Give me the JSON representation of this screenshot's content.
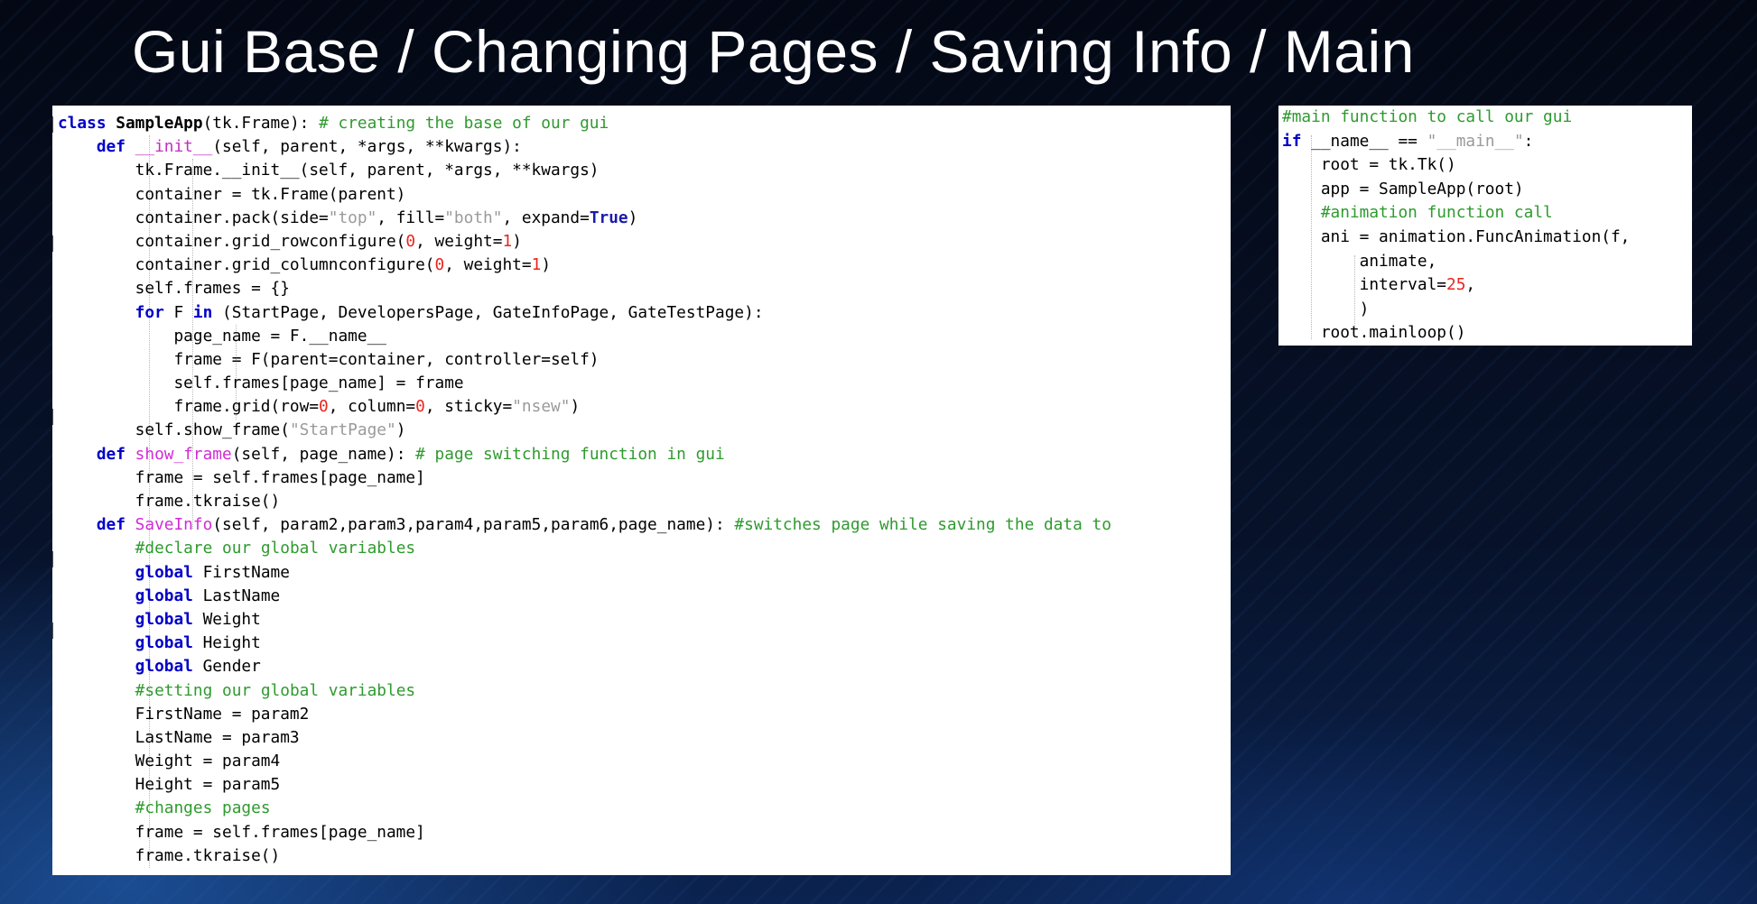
{
  "slide": {
    "title": "Gui Base / Changing Pages / Saving Info / Main"
  },
  "colors": {
    "keyword": "#0000c8",
    "comment": "#2f9a2f",
    "function_name": "#d12bd6",
    "number": "#e8261f",
    "string": "#9a9a9a",
    "builtin": "#1b1baa",
    "background": "#050b1a"
  },
  "code_left": {
    "lines": [
      [
        {
          "t": "class ",
          "c": "kw"
        },
        {
          "t": "SampleApp",
          "c": "bold"
        },
        {
          "t": "(tk.Frame): ",
          "c": ""
        },
        {
          "t": "# creating the base of our gui",
          "c": "cm"
        }
      ],
      [
        {
          "t": "    ",
          "c": ""
        },
        {
          "t": "def ",
          "c": "kw"
        },
        {
          "t": "__init__",
          "c": "dn"
        },
        {
          "t": "(self, parent, *args, **kwargs):",
          "c": ""
        }
      ],
      [
        {
          "t": "        tk.Frame.__init__(self, parent, *args, **kwargs)",
          "c": ""
        }
      ],
      [
        {
          "t": "        container = tk.Frame(parent)",
          "c": ""
        }
      ],
      [
        {
          "t": "        container.pack(side=",
          "c": ""
        },
        {
          "t": "\"top\"",
          "c": "st"
        },
        {
          "t": ", fill=",
          "c": ""
        },
        {
          "t": "\"both\"",
          "c": "st"
        },
        {
          "t": ", expand=",
          "c": ""
        },
        {
          "t": "True",
          "c": "bu"
        },
        {
          "t": ")",
          "c": ""
        }
      ],
      [
        {
          "t": "        container.grid_rowconfigure(",
          "c": ""
        },
        {
          "t": "0",
          "c": "nm"
        },
        {
          "t": ", weight=",
          "c": ""
        },
        {
          "t": "1",
          "c": "nm"
        },
        {
          "t": ")",
          "c": ""
        }
      ],
      [
        {
          "t": "        container.grid_columnconfigure(",
          "c": ""
        },
        {
          "t": "0",
          "c": "nm"
        },
        {
          "t": ", weight=",
          "c": ""
        },
        {
          "t": "1",
          "c": "nm"
        },
        {
          "t": ")",
          "c": ""
        }
      ],
      [
        {
          "t": "        self.frames = {}",
          "c": ""
        }
      ],
      [
        {
          "t": "        ",
          "c": ""
        },
        {
          "t": "for ",
          "c": "kw"
        },
        {
          "t": "F ",
          "c": ""
        },
        {
          "t": "in ",
          "c": "kw"
        },
        {
          "t": "(StartPage, DevelopersPage, GateInfoPage, GateTestPage):",
          "c": ""
        }
      ],
      [
        {
          "t": "            page_name = F.__name__",
          "c": ""
        }
      ],
      [
        {
          "t": "            frame = F(parent=container, controller=self)",
          "c": ""
        }
      ],
      [
        {
          "t": "            self.frames[page_name] = frame",
          "c": ""
        }
      ],
      [
        {
          "t": "            frame.grid(row=",
          "c": ""
        },
        {
          "t": "0",
          "c": "nm"
        },
        {
          "t": ", column=",
          "c": ""
        },
        {
          "t": "0",
          "c": "nm"
        },
        {
          "t": ", sticky=",
          "c": ""
        },
        {
          "t": "\"nsew\"",
          "c": "st"
        },
        {
          "t": ")",
          "c": ""
        }
      ],
      [
        {
          "t": "        self.show_frame(",
          "c": ""
        },
        {
          "t": "\"StartPage\"",
          "c": "st"
        },
        {
          "t": ")",
          "c": ""
        }
      ],
      [
        {
          "t": "    ",
          "c": ""
        },
        {
          "t": "def ",
          "c": "kw"
        },
        {
          "t": "show_frame",
          "c": "fn"
        },
        {
          "t": "(self, page_name): ",
          "c": ""
        },
        {
          "t": "# page switching function in gui",
          "c": "cm"
        }
      ],
      [
        {
          "t": "        frame = self.frames[page_name]",
          "c": ""
        }
      ],
      [
        {
          "t": "        frame.tkraise()",
          "c": ""
        }
      ],
      [
        {
          "t": "    ",
          "c": ""
        },
        {
          "t": "def ",
          "c": "kw"
        },
        {
          "t": "SaveInfo",
          "c": "fn"
        },
        {
          "t": "(self, param2,param3,param4,param5,param6,page_name): ",
          "c": ""
        },
        {
          "t": "#switches page while saving the data to",
          "c": "cm"
        }
      ],
      [
        {
          "t": "        ",
          "c": ""
        },
        {
          "t": "#declare our global variables",
          "c": "cm"
        }
      ],
      [
        {
          "t": "        ",
          "c": ""
        },
        {
          "t": "global ",
          "c": "kw"
        },
        {
          "t": "FirstName",
          "c": ""
        }
      ],
      [
        {
          "t": "        ",
          "c": ""
        },
        {
          "t": "global ",
          "c": "kw"
        },
        {
          "t": "LastName",
          "c": ""
        }
      ],
      [
        {
          "t": "        ",
          "c": ""
        },
        {
          "t": "global ",
          "c": "kw"
        },
        {
          "t": "Weight",
          "c": ""
        }
      ],
      [
        {
          "t": "        ",
          "c": ""
        },
        {
          "t": "global ",
          "c": "kw"
        },
        {
          "t": "Height",
          "c": ""
        }
      ],
      [
        {
          "t": "        ",
          "c": ""
        },
        {
          "t": "global ",
          "c": "kw"
        },
        {
          "t": "Gender",
          "c": ""
        }
      ],
      [
        {
          "t": "        ",
          "c": ""
        },
        {
          "t": "#setting our global variables",
          "c": "cm"
        }
      ],
      [
        {
          "t": "        FirstName = param2",
          "c": ""
        }
      ],
      [
        {
          "t": "        LastName = param3",
          "c": ""
        }
      ],
      [
        {
          "t": "        Weight = param4",
          "c": ""
        }
      ],
      [
        {
          "t": "        Height = param5",
          "c": ""
        }
      ],
      [
        {
          "t": "        ",
          "c": ""
        },
        {
          "t": "#changes pages",
          "c": "cm"
        }
      ],
      [
        {
          "t": "        frame = self.frames[page_name]",
          "c": ""
        }
      ],
      [
        {
          "t": "        frame.tkraise()",
          "c": ""
        }
      ]
    ]
  },
  "code_right": {
    "lines": [
      [
        {
          "t": "#main function to call our gui",
          "c": "cm"
        }
      ],
      [
        {
          "t": "if ",
          "c": "kw"
        },
        {
          "t": "__name__ == ",
          "c": ""
        },
        {
          "t": "\"__main__\"",
          "c": "st"
        },
        {
          "t": ":",
          "c": ""
        }
      ],
      [
        {
          "t": "    root = tk.Tk()",
          "c": ""
        }
      ],
      [
        {
          "t": "    app = SampleApp(root)",
          "c": ""
        }
      ],
      [
        {
          "t": "    ",
          "c": ""
        },
        {
          "t": "#animation function call",
          "c": "cm"
        }
      ],
      [
        {
          "t": "    ani = animation.FuncAnimation(f,",
          "c": ""
        }
      ],
      [
        {
          "t": "        animate,",
          "c": ""
        }
      ],
      [
        {
          "t": "        interval=",
          "c": ""
        },
        {
          "t": "25",
          "c": "nm"
        },
        {
          "t": ",",
          "c": ""
        }
      ],
      [
        {
          "t": "        )",
          "c": ""
        }
      ],
      [
        {
          "t": "    root.mainloop()",
          "c": ""
        }
      ]
    ]
  }
}
